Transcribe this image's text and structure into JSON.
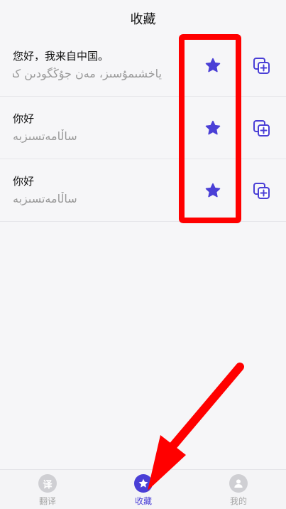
{
  "header": {
    "title": "收藏"
  },
  "favorites": [
    {
      "chinese": "您好，我来自中国。",
      "uyghur": "ياخشىمۇسىز، مەن جۇڭگودىن كەلدىم."
    },
    {
      "chinese": "你好",
      "uyghur": "ساڵامەتسىزبە"
    },
    {
      "chinese": "你好",
      "uyghur": "ساڵامەتسىزبە"
    }
  ],
  "tabs": [
    {
      "label": "翻译",
      "icon_text": "译"
    },
    {
      "label": "收藏"
    },
    {
      "label": "我的"
    }
  ],
  "colors": {
    "accent": "#4a3fd6",
    "annotation": "#ff0000",
    "inactive": "#cfcfd3"
  }
}
